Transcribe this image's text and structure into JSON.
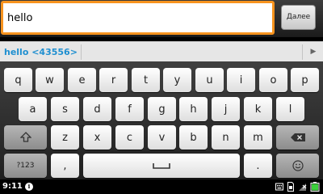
{
  "input": {
    "value": "hello"
  },
  "action_button": {
    "label": "Далее"
  },
  "suggestions": {
    "items": [
      "hello <43556>"
    ],
    "more_icon": "triangle-right-icon"
  },
  "keyboard": {
    "rows": [
      [
        "q",
        "w",
        "e",
        "r",
        "t",
        "y",
        "u",
        "i",
        "o",
        "p"
      ],
      [
        "a",
        "s",
        "d",
        "f",
        "g",
        "h",
        "j",
        "k",
        "l"
      ],
      [
        "z",
        "x",
        "c",
        "v",
        "b",
        "n",
        "m"
      ]
    ],
    "shift_icon": "shift-arrow-icon",
    "delete_icon": "backspace-icon",
    "symbols_label": "?123",
    "comma_label": ",",
    "space_icon": "space-bar-icon",
    "period_label": ".",
    "enter_icon": "smiley-icon"
  },
  "status_bar": {
    "time": "9:11",
    "notification_icon": "info-icon",
    "right_icons": [
      "keyboard-icon",
      "sim-icon",
      "no-signal-icon",
      "battery-icon"
    ]
  },
  "colors": {
    "input_border": "#f7931e",
    "suggestion_text": "#1f8fd0",
    "keyboard_bg": "#2e2e2e",
    "battery": "#3ccf3c"
  }
}
